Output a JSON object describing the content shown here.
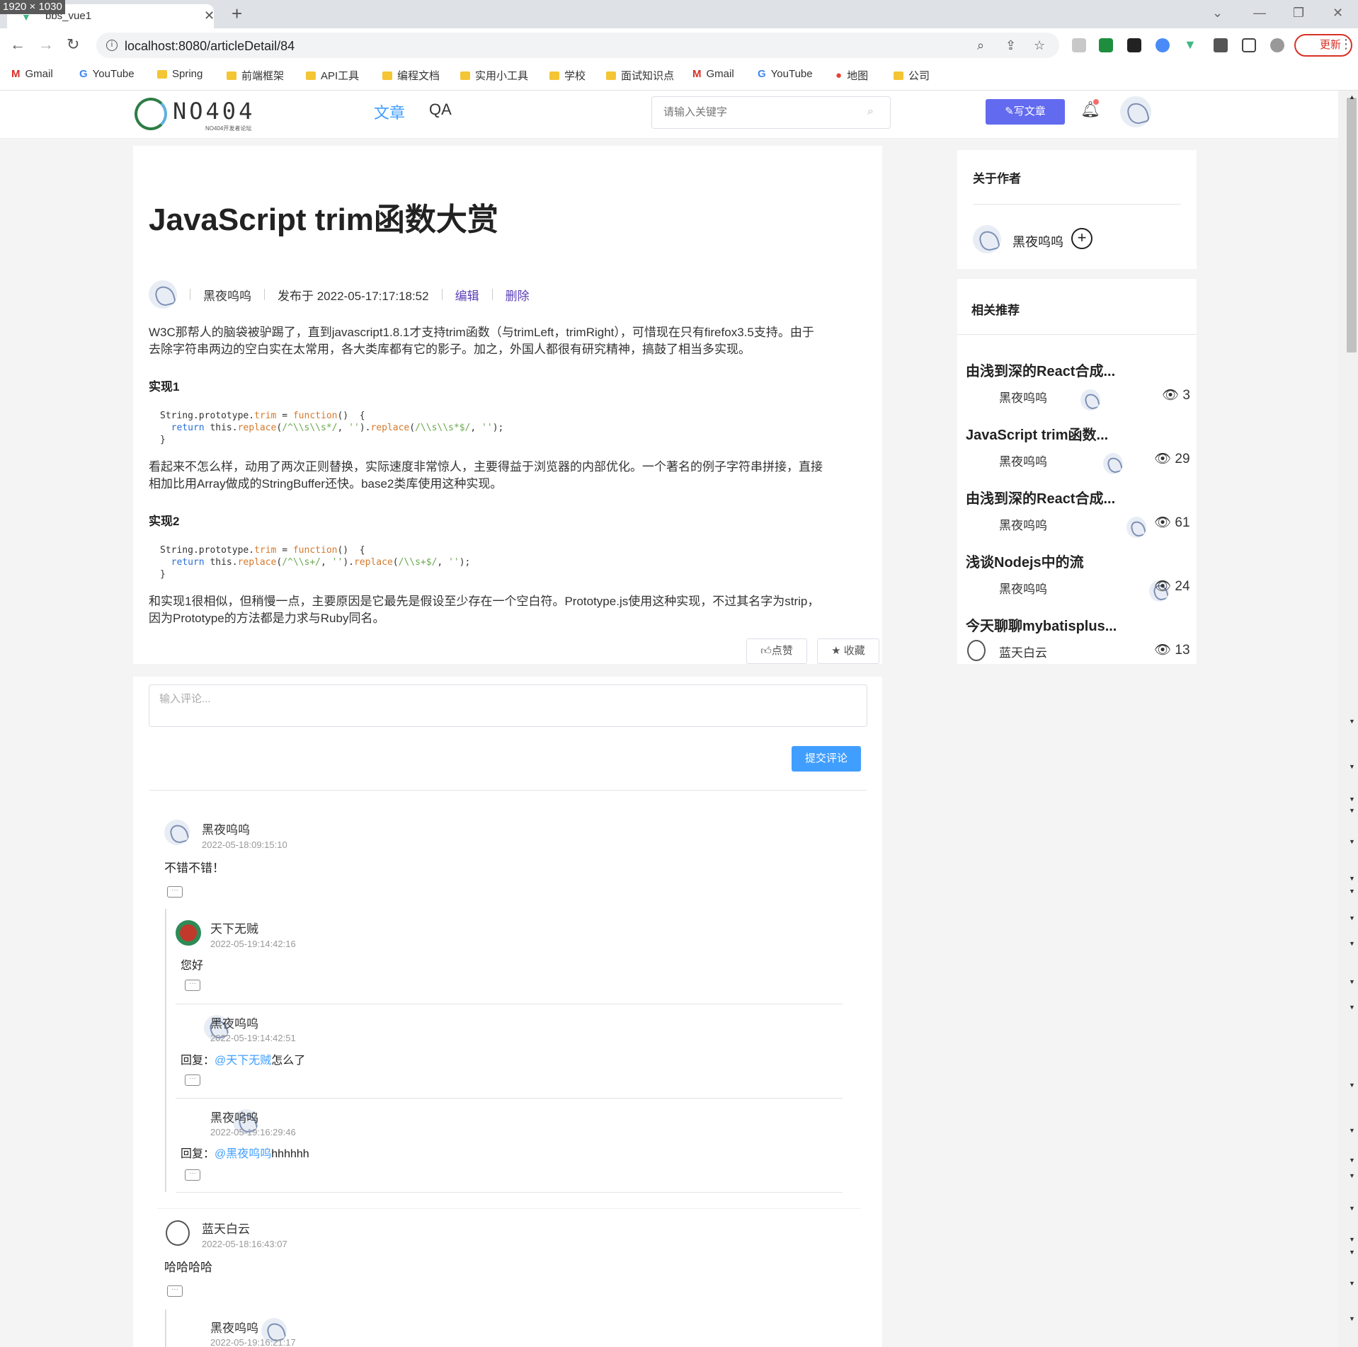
{
  "overlay": {
    "dims": "1920 × 1030"
  },
  "browser": {
    "tab_title": "bbs_vue1",
    "url": "localhost:8080/articleDetail/84",
    "update_label": "更新",
    "bookmarks": [
      "Gmail",
      "YouTube",
      "Spring",
      "前端框架",
      "API工具",
      "编程文档",
      "实用小工具",
      "学校",
      "面试知识点",
      "Gmail",
      "YouTube",
      "地图",
      "公司"
    ]
  },
  "site": {
    "logo": "NO404",
    "logo_sub": "NO404开发者论坛",
    "nav": [
      "文章",
      "QA"
    ],
    "search_placeholder": "请输入关键字",
    "write_label": "写文章"
  },
  "article": {
    "title": "JavaScript trim函数大赏",
    "author": "黑夜呜呜",
    "published": "发布于 2022-05-17:17:18:52",
    "edit": "编辑",
    "delete": "删除",
    "p1a": "W3C那帮人的脑袋被驴踢了，直到javascript1.8.1才支持trim函数（与trimLeft，trimRight），可惜现在只有firefox3.5支持。由于",
    "p1b": "去除字符串两边的空白实在太常用，各大类库都有它的影子。加之，外国人都很有研究精神，搞鼓了相当多实现。",
    "h1": "实现1",
    "p2a": "看起来不怎么样，动用了两次正则替换，实际速度非常惊人，主要得益于浏览器的内部优化。一个著名的例子字符串拼接，直接",
    "p2b": "相加比用Array做成的StringBuffer还快。base2类库使用这种实现。",
    "h2": "实现2",
    "p3a": "和实现1很相似，但稍慢一点，主要原因是它最先是假设至少存在一个空白符。Prototype.js使用这种实现，不过其名字为strip，",
    "p3b": "因为Prototype的方法都是力求与Ruby同名。",
    "like": "点赞",
    "collect": "收藏"
  },
  "comments": {
    "placeholder": "输入评论...",
    "submit": "提交评论",
    "items": [
      {
        "name": "黑夜呜呜",
        "time": "2022-05-18:09:15:10",
        "text": "不错不错！"
      },
      {
        "name": "天下无贼",
        "time": "2022-05-19:14:42:16",
        "text": "您好"
      },
      {
        "name": "黑夜呜呜",
        "time": "2022-05-19:14:42:51",
        "prefix": "回复：",
        "at": "@天下无贼",
        "text": "怎么了"
      },
      {
        "name": "黑夜呜呜",
        "time": "2022-05-19:16:29:46",
        "prefix": "回复：",
        "at": "@黑夜呜呜",
        "text": "hhhhhh"
      },
      {
        "name": "蓝天白云",
        "time": "2022-05-18:16:43:07",
        "text": "哈哈哈哈"
      },
      {
        "name": "黑夜呜呜",
        "time": "2022-05-19:16:21:17"
      }
    ]
  },
  "sidebar": {
    "about_title": "关于作者",
    "author": "黑夜呜呜",
    "rec_title": "相关推荐",
    "recs": [
      {
        "title": "由浅到深的React合成...",
        "author": "黑夜呜呜",
        "views": "3"
      },
      {
        "title": "JavaScript trim函数...",
        "author": "黑夜呜呜",
        "views": "29"
      },
      {
        "title": "由浅到深的React合成...",
        "author": "黑夜呜呜",
        "views": "61"
      },
      {
        "title": "浅谈Nodejs中的流",
        "author": "黑夜呜呜",
        "views": "24"
      },
      {
        "title": "今天聊聊mybatisplus...",
        "author": "蓝天白云",
        "views": "13"
      }
    ]
  }
}
